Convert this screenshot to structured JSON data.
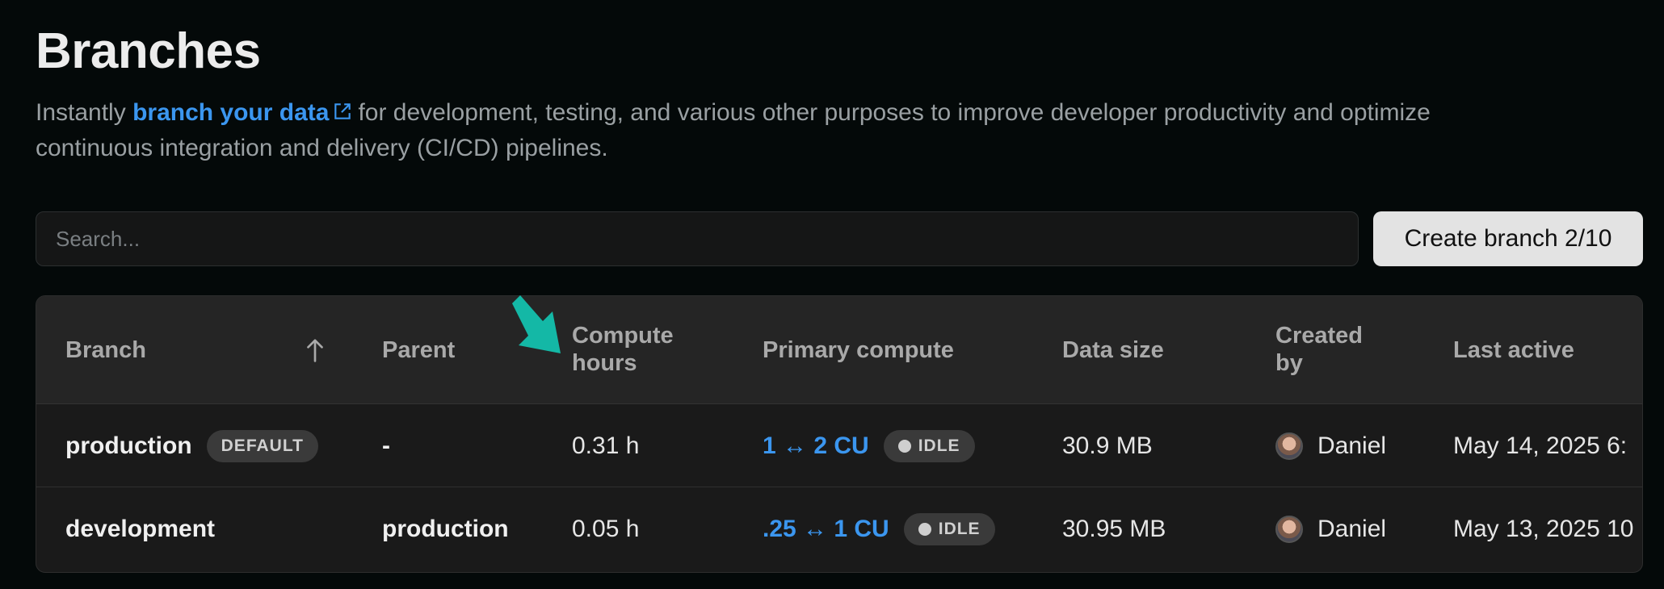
{
  "page": {
    "title": "Branches",
    "description_before": "Instantly ",
    "description_link": "branch your data",
    "description_after": "for development, testing, and various other purposes to improve developer productivity and optimize continuous integration and delivery (CI/CD) pipelines."
  },
  "toolbar": {
    "search_placeholder": "Search...",
    "create_label": "Create branch 2/10"
  },
  "table": {
    "headers": {
      "branch": "Branch",
      "parent": "Parent",
      "compute_hours_1": "Compute",
      "compute_hours_2": "hours",
      "primary_compute": "Primary compute",
      "data_size": "Data size",
      "created_by_1": "Created",
      "created_by_2": "by",
      "last_active": "Last active"
    },
    "rows": [
      {
        "branch": "production",
        "badge": "DEFAULT",
        "parent": "-",
        "compute_hours": "0.31 h",
        "primary_compute": "1 ↔ 2 CU",
        "status": "IDLE",
        "data_size": "30.9 MB",
        "created_by": "Daniel",
        "last_active": "May 14, 2025 6:"
      },
      {
        "branch": "development",
        "badge": "",
        "parent": "production",
        "compute_hours": "0.05 h",
        "primary_compute": ".25 ↔ 1 CU",
        "status": "IDLE",
        "data_size": "30.95 MB",
        "created_by": "Daniel",
        "last_active": "May 13, 2025 10"
      }
    ]
  },
  "colors": {
    "background": "#040909",
    "link": "#3b96ef",
    "annotation_arrow": "#14b8a6"
  },
  "icons": [
    "external-link-icon",
    "sort-ascending-icon",
    "annotation-arrow-icon",
    "avatar"
  ]
}
